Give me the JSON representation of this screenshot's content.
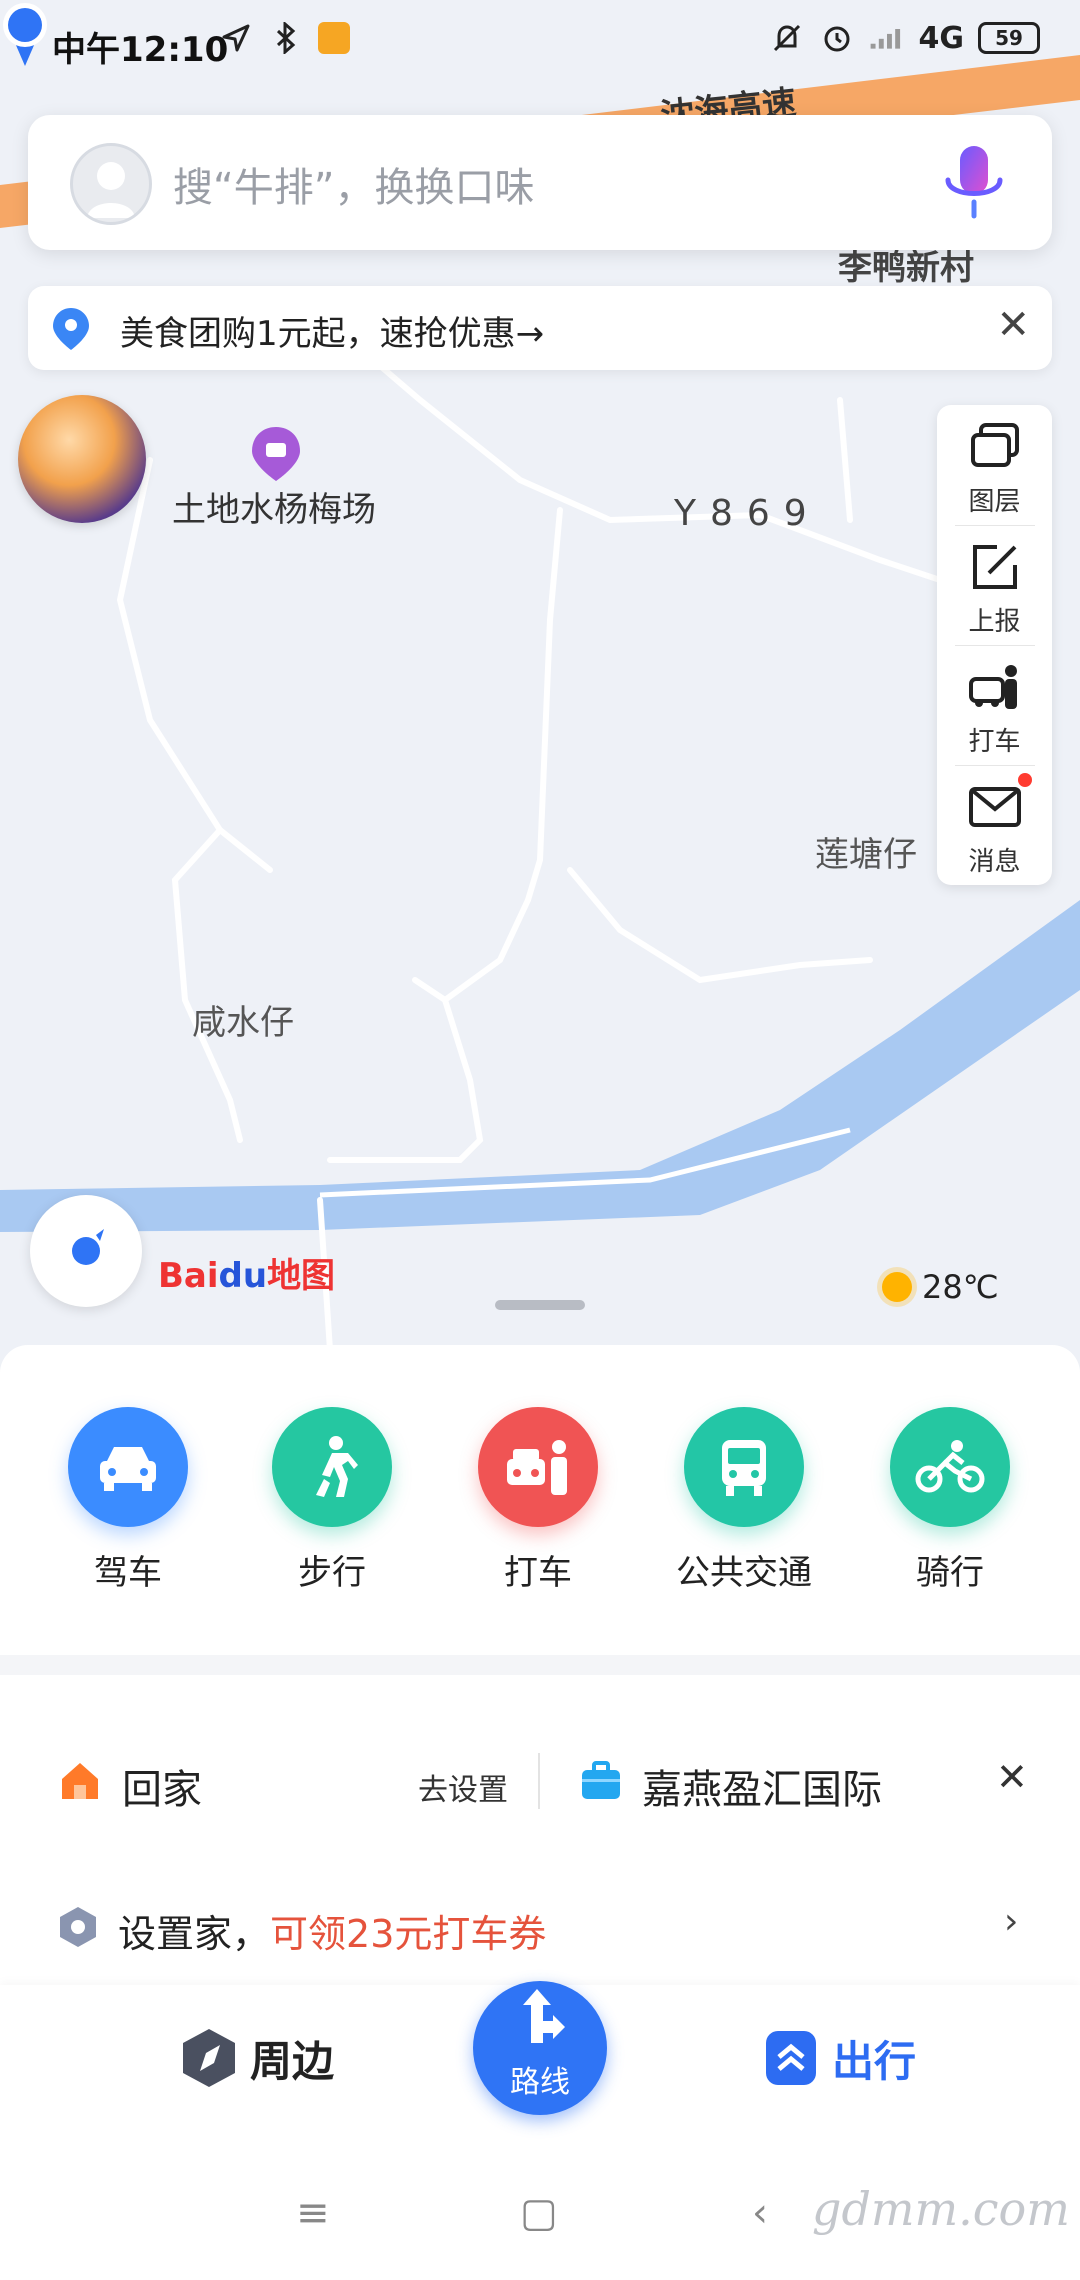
{
  "status_bar": {
    "time": "中午12:10",
    "network": "4G",
    "battery": "59"
  },
  "search": {
    "placeholder": "搜“牛排”，换换口味"
  },
  "promo": {
    "text": "美食团购1元起，速抢优惠→",
    "close": "✕"
  },
  "map": {
    "labels": {
      "expressway": "沈海高速",
      "village_top": "李鸭新村",
      "poi": "土地水杨梅场",
      "road": "Y869",
      "lianting": "莲塘仔",
      "xianshui": "咸水仔"
    },
    "logo_bai": "Bai",
    "logo_du": "du",
    "logo_map": "地图",
    "weather": "28℃"
  },
  "right_toolbar": {
    "layers": "图层",
    "report": "上报",
    "taxi": "打车",
    "messages": "消息"
  },
  "modes": [
    {
      "label": "驾车",
      "color": "#3b8cff"
    },
    {
      "label": "步行",
      "color": "#25c7a1"
    },
    {
      "label": "打车",
      "color": "#f05454"
    },
    {
      "label": "公共交通",
      "color": "#23c6a6"
    },
    {
      "label": "骑行",
      "color": "#25c7a1"
    }
  ],
  "shortcuts": {
    "home": "回家",
    "go_set": "去设置",
    "work": "嘉燕盈汇国际",
    "close": "✕",
    "set_home": "设置家，",
    "set_home_offer": "可领23元打车券",
    "chevron": "›"
  },
  "tabbar": {
    "nearby": "周边",
    "route": "路线",
    "trip": "出行"
  },
  "navbar": {
    "menu": "≡",
    "home": "▢",
    "back": "‹"
  },
  "watermark": "gdmm.com"
}
